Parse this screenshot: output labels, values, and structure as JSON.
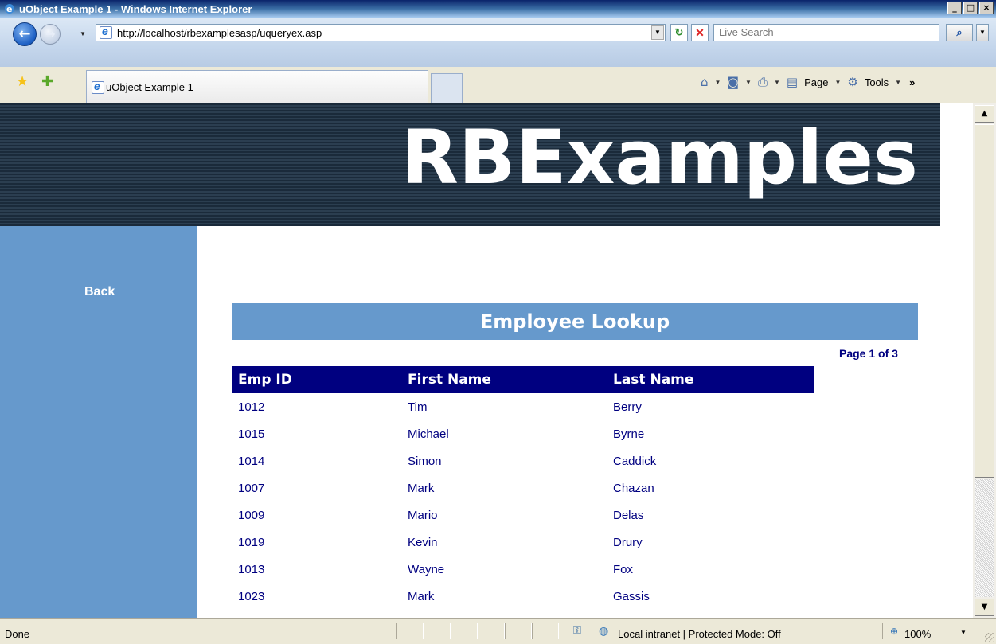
{
  "window": {
    "title": "uObject Example 1 - Windows Internet Explorer",
    "minimize": "_",
    "maximize": "□",
    "close": "×"
  },
  "address_bar": {
    "url": "http://localhost/rbexamplesasp/uqueryex.asp",
    "search_placeholder": "Live Search"
  },
  "tabs": [
    {
      "label": "uObject Example 1"
    }
  ],
  "command_bar": {
    "page_label": "Page",
    "tools_label": "Tools"
  },
  "page": {
    "banner_title": "RBExamples",
    "sidebar": {
      "back_label": "Back"
    },
    "heading": "Employee Lookup",
    "pager": "Page 1 of 3",
    "table": {
      "headers": [
        "Emp ID",
        "First Name",
        "Last Name"
      ],
      "rows": [
        [
          "1012",
          "Tim",
          "Berry"
        ],
        [
          "1015",
          "Michael",
          "Byrne"
        ],
        [
          "1014",
          "Simon",
          "Caddick"
        ],
        [
          "1007",
          "Mark",
          "Chazan"
        ],
        [
          "1009",
          "Mario",
          "Delas"
        ],
        [
          "1019",
          "Kevin",
          "Drury"
        ],
        [
          "1013",
          "Wayne",
          "Fox"
        ],
        [
          "1023",
          "Mark",
          "Gassis"
        ]
      ]
    }
  },
  "status_bar": {
    "status": "Done",
    "zone": "Local intranet | Protected Mode: Off",
    "zoom": "100%"
  },
  "colors": {
    "banner_bg": "#1a2a3a",
    "sidebar_bg": "#6699cc",
    "table_header_bg": "#000080",
    "table_text": "#000080"
  }
}
